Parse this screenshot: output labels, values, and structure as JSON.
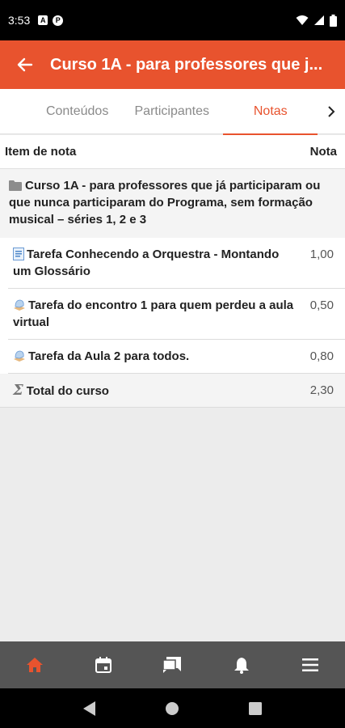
{
  "status_bar": {
    "time": "3:53",
    "icons": [
      "notification-a-icon",
      "notification-p-icon",
      "wifi-icon",
      "signal-icon",
      "battery-icon"
    ]
  },
  "app_bar": {
    "title": "Curso 1A - para professores que j...",
    "back_icon": "arrow-left-icon"
  },
  "tabs": [
    {
      "label": "Conteúdos",
      "active": false
    },
    {
      "label": "Participantes",
      "active": false
    },
    {
      "label": "Notas",
      "active": true
    }
  ],
  "grades": {
    "header": {
      "item_label": "Item de nota",
      "grade_label": "Nota"
    },
    "category": "Curso 1A - para professores que já participaram ou que nunca participaram do Programa, sem formação musical – séries 1, 2 e 3",
    "items": [
      {
        "name": "Tarefa Conhecendo a Orquestra - Montando um Glossário",
        "grade": "1,00",
        "icon": "glossary-icon"
      },
      {
        "name": "Tarefa do encontro 1 para quem perdeu a aula virtual",
        "grade": "0,50",
        "icon": "assignment-icon"
      },
      {
        "name": "Tarefa da Aula 2 para todos.",
        "grade": "0,80",
        "icon": "assignment-icon"
      }
    ],
    "total": {
      "name": "Total do curso",
      "grade": "2,30"
    }
  },
  "bottom_nav": [
    "home-icon",
    "calendar-icon",
    "messages-icon",
    "notifications-icon",
    "menu-icon"
  ],
  "colors": {
    "accent": "#e8532e",
    "nav_bg": "#555555"
  }
}
